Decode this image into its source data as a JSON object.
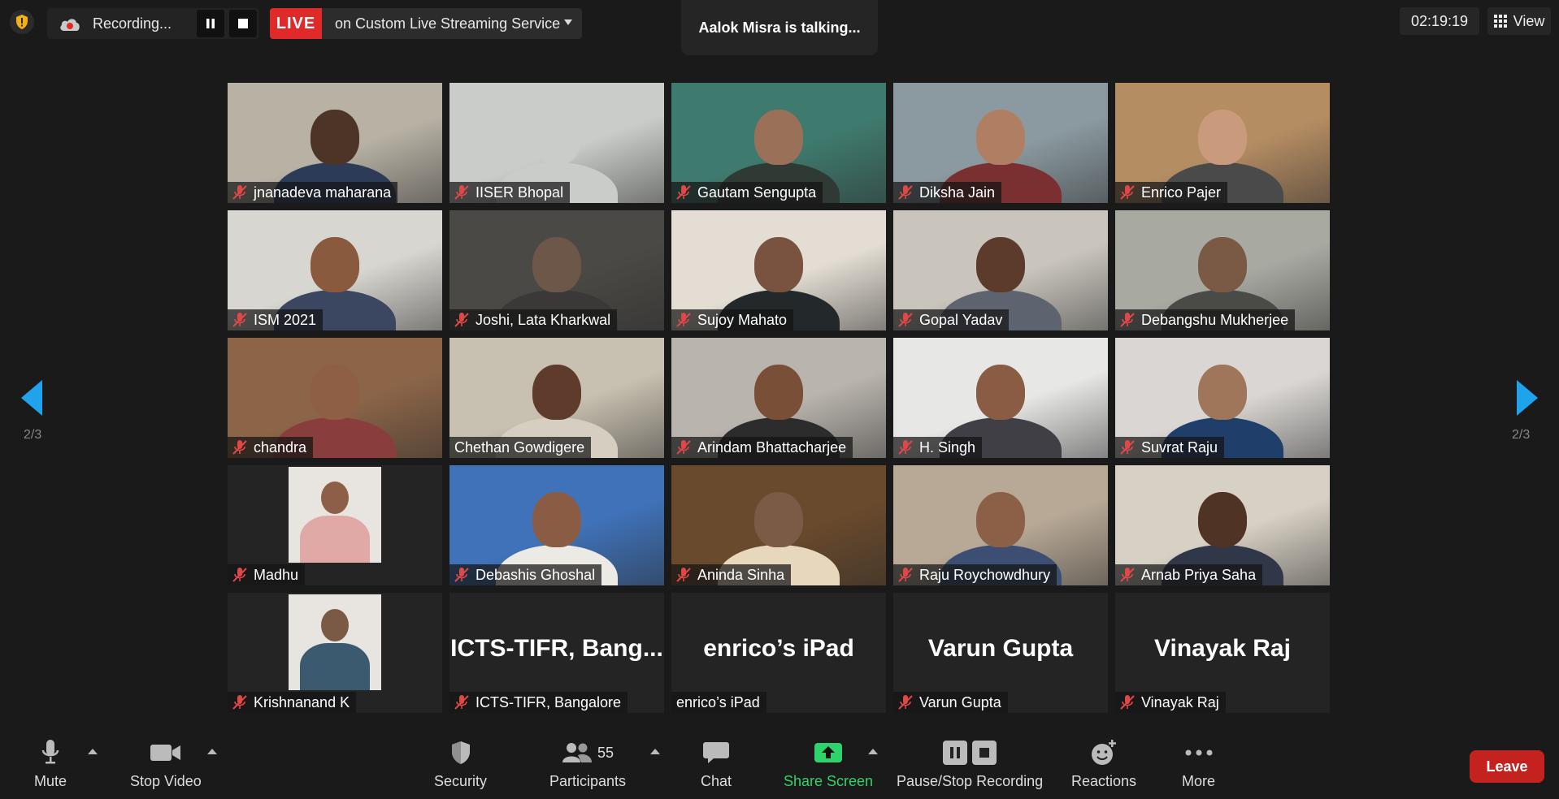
{
  "header": {
    "recording_label": "Recording...",
    "live_label": "LIVE",
    "live_service": "on Custom Live Streaming Service",
    "talking_indicator": "Aalok Misra is talking...",
    "meeting_time": "02:19:19",
    "view_label": "View"
  },
  "pager": {
    "left": "2/3",
    "right": "2/3"
  },
  "participants": [
    {
      "name": "jnanadeva maharana",
      "muted": true,
      "bg": "#b8b2a5",
      "skin": "#4e3426",
      "shirt": "#2c3b58"
    },
    {
      "name": "IISER Bhopal",
      "muted": true,
      "bg": "#c9ccc8",
      "skin": "#c9ccc8",
      "shirt": "#c9ccc8"
    },
    {
      "name": "Gautam Sengupta",
      "muted": true,
      "bg": "#3f7a6e",
      "skin": "#9b7059",
      "shirt": "#2f3a34"
    },
    {
      "name": "Diksha Jain",
      "muted": true,
      "bg": "#8b9aa0",
      "skin": "#b07f63",
      "shirt": "#7a3030"
    },
    {
      "name": "Enrico Pajer",
      "muted": true,
      "bg": "#b58d63",
      "skin": "#c99a7c",
      "shirt": "#4b4a4a"
    },
    {
      "name": "ISM 2021",
      "muted": true,
      "bg": "#d8d6d0",
      "skin": "#8a5a3f",
      "shirt": "#3b4660"
    },
    {
      "name": "Joshi, Lata Kharkwal",
      "muted": true,
      "bg": "#4a4945",
      "skin": "#6c5748",
      "shirt": "#3a3937"
    },
    {
      "name": "Sujoy Mahato",
      "muted": true,
      "bg": "#e3ddd3",
      "skin": "#7a5240",
      "shirt": "#23282a"
    },
    {
      "name": "Gopal Yadav",
      "muted": true,
      "bg": "#c9c5bd",
      "skin": "#5c3b2c",
      "shirt": "#5d6470"
    },
    {
      "name": "Debangshu Mukherjee",
      "muted": true,
      "bg": "#a8aaa2",
      "skin": "#7a5a45",
      "shirt": "#4a4b47"
    },
    {
      "name": "chandra",
      "muted": true,
      "bg": "#8c6548",
      "skin": "#8e5e45",
      "shirt": "#8a3d3d"
    },
    {
      "name": "Chethan Gowdigere",
      "muted": false,
      "bg": "#c8c0b0",
      "skin": "#5e3b2b",
      "shirt": "#d6cfc1"
    },
    {
      "name": "Arindam Bhattacharjee",
      "muted": true,
      "bg": "#b9b4ad",
      "skin": "#7a4f38",
      "shirt": "#2c2c2c"
    },
    {
      "name": "H. Singh",
      "muted": true,
      "bg": "#e7e7e6",
      "skin": "#8a5c44",
      "shirt": "#3f3f45"
    },
    {
      "name": "Suvrat Raju",
      "muted": true,
      "bg": "#d9d6d3",
      "skin": "#a0765b",
      "shirt": "#1f3f6a"
    },
    {
      "name": "Madhu",
      "muted": true,
      "bg": "#242424",
      "skin": "#8d5f48",
      "shirt": "#e0a9a6",
      "portrait": true
    },
    {
      "name": "Debashis Ghoshal",
      "muted": true,
      "bg": "#3f72b8",
      "skin": "#8a5c44",
      "shirt": "#eceae4"
    },
    {
      "name": "Aninda Sinha",
      "muted": true,
      "bg": "#6a4a2c",
      "skin": "#7b5a46",
      "shirt": "#e6d7bd"
    },
    {
      "name": "Raju Roychowdhury",
      "muted": true,
      "bg": "#b8a996",
      "skin": "#8c6047",
      "shirt": "#3c4f72"
    },
    {
      "name": "Arnab Priya Saha",
      "muted": true,
      "bg": "#d7d0c4",
      "skin": "#4f3324",
      "shirt": "#2f3748"
    },
    {
      "name": "Krishnanand K",
      "muted": true,
      "bg": "#242424",
      "skin": "#7a5a45",
      "shirt": "#3b5a70",
      "portrait": true
    },
    {
      "name": "ICTS-TIFR, Bangalore",
      "muted": true,
      "video_off": true,
      "display": "ICTS-TIFR,  Bang..."
    },
    {
      "name": "enrico’s iPad",
      "muted": false,
      "video_off": true,
      "display": "enrico’s iPad"
    },
    {
      "name": "Varun Gupta",
      "muted": true,
      "video_off": true,
      "display": "Varun Gupta"
    },
    {
      "name": "Vinayak Raj",
      "muted": true,
      "video_off": true,
      "display": "Vinayak Raj"
    }
  ],
  "toolbar": {
    "mute": "Mute",
    "stop_video": "Stop Video",
    "security": "Security",
    "participants": "Participants",
    "participant_count": "55",
    "chat": "Chat",
    "share_screen": "Share Screen",
    "pause_stop_recording": "Pause/Stop Recording",
    "reactions": "Reactions",
    "more": "More",
    "leave": "Leave"
  },
  "colors": {
    "background": "#1a1a1a",
    "live_red": "#e02a2a",
    "leave_red": "#c4221f",
    "share_green": "#2fd36b",
    "pager_blue": "#1fa3ec",
    "muted_red": "#e04848"
  }
}
